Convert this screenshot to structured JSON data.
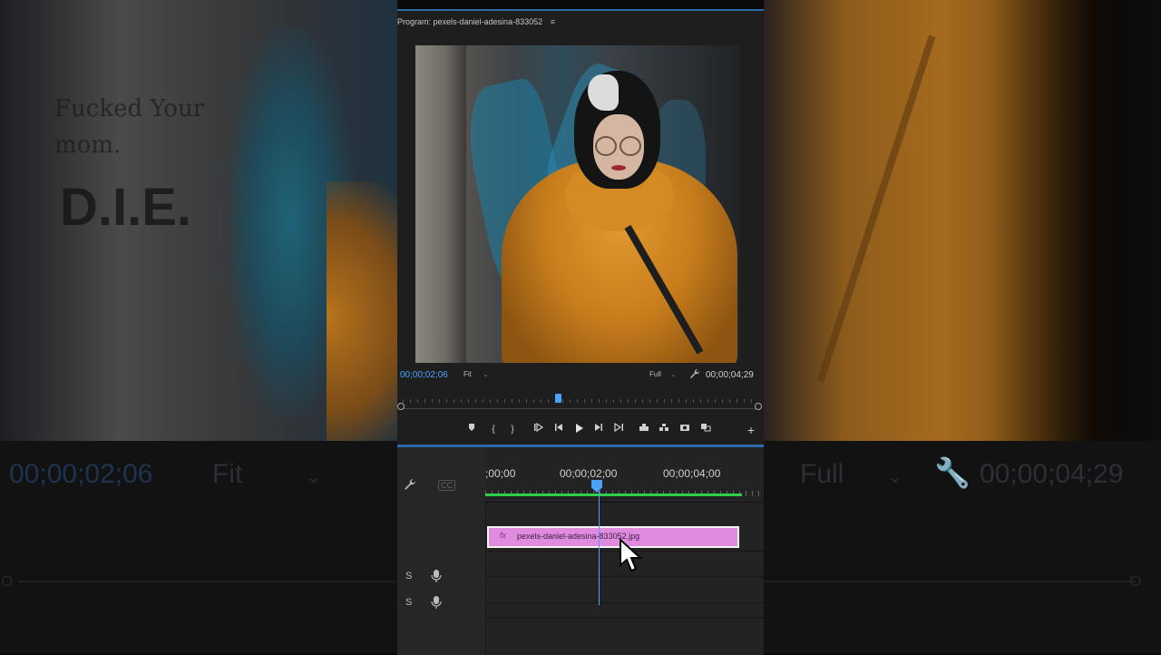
{
  "panel": {
    "title": "Program: pexels-daniel-adesina-833052",
    "menu_glyph": "≡"
  },
  "monitor": {
    "timecode_current": "00;00;02;06",
    "zoom_select": "Fit",
    "resolution_select": "Full",
    "timecode_duration": "00;00;04;29",
    "playhead_fraction": 0.43
  },
  "timeline": {
    "ruler_labels": [
      ";00;00",
      "00;00;02;00",
      "00;00;04;00"
    ],
    "clip_name": "pexels-daniel-adesina-833052.jpg",
    "clip_fx": "fx",
    "audio_tracks": [
      {
        "solo": "S",
        "mic": "mic-icon"
      },
      {
        "solo": "S",
        "mic": "mic-icon"
      }
    ]
  },
  "background_ghost": {
    "timecode_current": "00;00;02;06",
    "zoom_select": "Fit",
    "resolution_select": "Full",
    "timecode_duration": "00;00;04;29",
    "scrawl_line1": "Fucked Your",
    "scrawl_line2": "mom.",
    "scrawl_big": "D.I.E."
  },
  "colors": {
    "accent_blue": "#4aa3ff",
    "clip_pink": "#e08be0",
    "work_area_green": "#2bd24b",
    "panel_bg": "#1e1e1e"
  }
}
